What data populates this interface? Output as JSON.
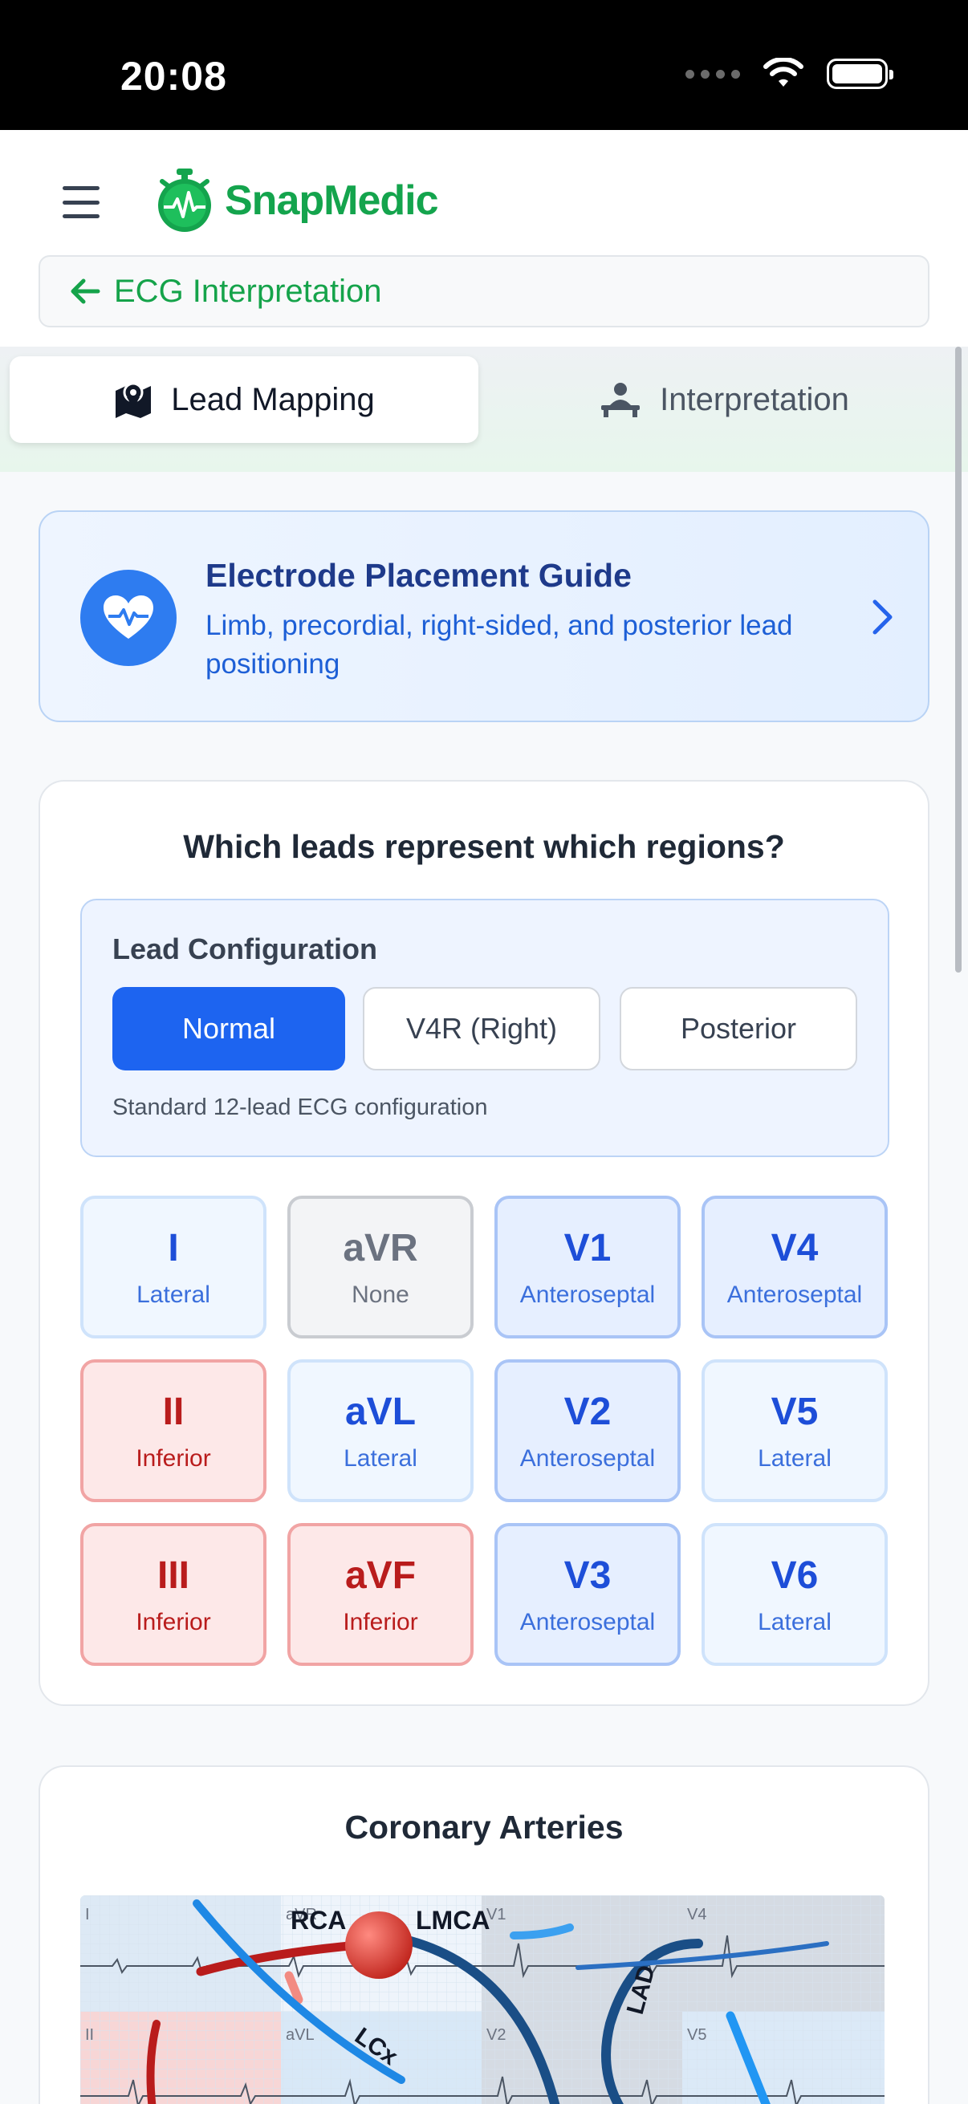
{
  "status_bar": {
    "time": "20:08"
  },
  "header": {
    "app_name": "SnapMedic",
    "back_label": "ECG Interpretation"
  },
  "tabs": [
    {
      "label": "Lead Mapping",
      "icon": "map-icon",
      "active": true
    },
    {
      "label": "Interpretation",
      "icon": "patient-icon",
      "active": false
    }
  ],
  "guide": {
    "title": "Electrode Placement Guide",
    "subtitle": "Limb, precordial, right-sided, and posterior lead positioning",
    "icon": "heart-pulse-icon"
  },
  "lead_section": {
    "title": "Which leads represent which regions?",
    "config_label": "Lead Configuration",
    "options": [
      "Normal",
      "V4R (Right)",
      "Posterior"
    ],
    "selected": "Normal",
    "description": "Standard 12-lead ECG configuration",
    "leads": [
      {
        "name": "I",
        "region": "Lateral",
        "type": "lateral"
      },
      {
        "name": "aVR",
        "region": "None",
        "type": "none"
      },
      {
        "name": "V1",
        "region": "Anteroseptal",
        "type": "antero"
      },
      {
        "name": "V4",
        "region": "Anteroseptal",
        "type": "antero"
      },
      {
        "name": "II",
        "region": "Inferior",
        "type": "inferior"
      },
      {
        "name": "aVL",
        "region": "Lateral",
        "type": "lateral"
      },
      {
        "name": "V2",
        "region": "Anteroseptal",
        "type": "antero"
      },
      {
        "name": "V5",
        "region": "Lateral",
        "type": "lateral"
      },
      {
        "name": "III",
        "region": "Inferior",
        "type": "inferior"
      },
      {
        "name": "aVF",
        "region": "Inferior",
        "type": "inferior"
      },
      {
        "name": "V3",
        "region": "Anteroseptal",
        "type": "antero"
      },
      {
        "name": "V6",
        "region": "Lateral",
        "type": "lateral"
      }
    ]
  },
  "coronary": {
    "title": "Coronary Arteries",
    "artery_labels": [
      "RCA",
      "LMCA",
      "LCx",
      "LAD"
    ],
    "lead_labels": [
      "I",
      "aVR",
      "V1",
      "V4",
      "II",
      "aVL",
      "V2",
      "V5"
    ]
  },
  "colors": {
    "brand": "#14a44d",
    "primary": "#1d64f0",
    "inferior": "#b91c1c",
    "anteroseptal": "#1d4ed8"
  }
}
